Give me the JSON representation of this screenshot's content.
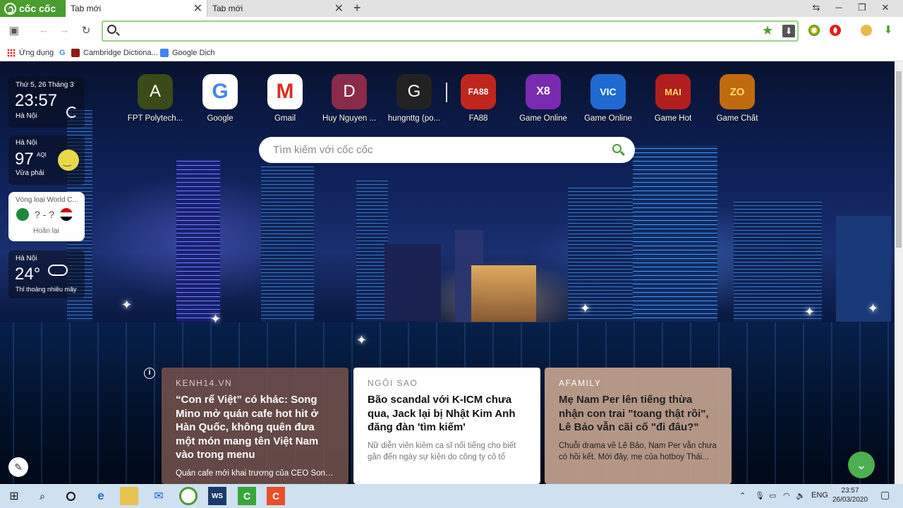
{
  "browser": {
    "brand": "cốc cốc",
    "tabs": [
      {
        "label": "Tab mới"
      },
      {
        "label": "Tab mới"
      }
    ],
    "address": {
      "value": "",
      "placeholder": ""
    },
    "bookmarks": [
      {
        "label": "Ứng dụng"
      },
      {
        "label": "Cambridge Dictiona..."
      },
      {
        "label": "Google Dịch"
      }
    ]
  },
  "speed_dial": [
    {
      "label": "FPT Polytech...",
      "letter": "A",
      "color": "#3a4a18"
    },
    {
      "label": "Google",
      "letter": "G",
      "color": "#ffffff"
    },
    {
      "label": "Gmail",
      "letter": "M",
      "color": "#ffffff"
    },
    {
      "label": "Huy Nguyen ...",
      "letter": "D",
      "color": "#8b2b4a"
    },
    {
      "label": "hungnttg (po...",
      "letter": "G",
      "color": "#222222"
    },
    {
      "label": "FA88",
      "letter": "FA88",
      "color": "#c0261c"
    },
    {
      "label": "Game Online",
      "letter": "X8",
      "color": "#7a2ab0"
    },
    {
      "label": "Game Online",
      "letter": "VIC",
      "color": "#1e6ad0"
    },
    {
      "label": "Game Hot",
      "letter": "MAI",
      "color": "#b01e1e"
    },
    {
      "label": "Game Chất",
      "letter": "ZO",
      "color": "#c06a10"
    }
  ],
  "search": {
    "placeholder": "Tìm kiếm với cốc cốc"
  },
  "widgets": {
    "clock": {
      "date": "Thứ 5, 26 Tháng 3",
      "time": "23:57",
      "city": "Hà Nội"
    },
    "air": {
      "city": "Hà Nội",
      "aqi": "97",
      "aqi_label": "AQI",
      "status": "Vừa phải"
    },
    "football": {
      "title": "Vòng loại World C...",
      "score": "? - ?",
      "status": "Hoãn lại"
    },
    "weather": {
      "city": "Hà Nội",
      "temp": "24°",
      "desc": "Thỉ thoảng nhiều mây"
    }
  },
  "news": [
    {
      "source": "KENH14.VN",
      "title": "“Con rể Việt” có khác: Song Mino mở quán cafe hot hit ở Hàn Quốc, không quên đưa một món mang tên Việt Nam vào trong menu",
      "desc": "Quán cafe mới khai trương của CEO Song..."
    },
    {
      "source": "NGÔI SAO",
      "title": "Bão scandal với K-ICM chưa qua, Jack lại bị Nhật Kim Anh đăng đàn 'tìm kiếm'",
      "desc": "Nữ diễn viên kiêm ca sĩ nổi tiếng cho biết gần đến ngày sự kiện do công ty cô tổ chức..."
    },
    {
      "source": "AFAMILY",
      "title": "Mẹ Nam Per lên tiếng thừa nhận con trai \"toang thật rồi\", Lê Bảo vẫn cãi cố \"đi đâu?\"",
      "desc": "Chuỗi drama về Lê Bảo, Nam Per vẫn chưa có hồi kết. Mới đây, mẹ của hotboy Thái..."
    }
  ],
  "taskbar": {
    "lang": "ENG",
    "time": "23:57",
    "date": "26/03/2020"
  }
}
